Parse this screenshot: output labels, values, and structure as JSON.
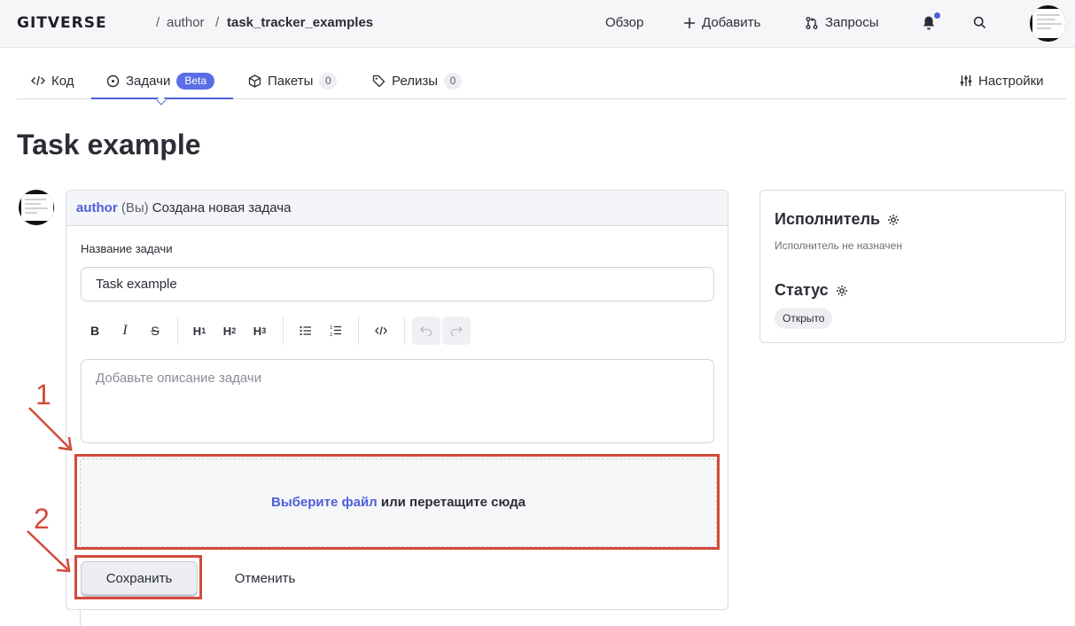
{
  "header": {
    "logo": "GITVERSE",
    "separator": "/",
    "owner": "author",
    "repo": "task_tracker_examples",
    "nav": {
      "overview": "Обзор",
      "add": "Добавить",
      "requests": "Запросы"
    },
    "icons": [
      "plus-icon",
      "pull-request-icon",
      "bell-icon",
      "search-icon"
    ]
  },
  "tabs": {
    "code": "Код",
    "issues": "Задачи",
    "issues_badge": "Beta",
    "packages": "Пакеты",
    "packages_count": "0",
    "releases": "Релизы",
    "releases_count": "0",
    "settings": "Настройки"
  },
  "page": {
    "title": "Task example"
  },
  "comment": {
    "author": "author",
    "you": "(Вы)",
    "action": "Создана новая задача",
    "title_label": "Название задачи",
    "title_value": "Task example",
    "toolbar": {
      "bold": "B",
      "italic": "I",
      "strike": "S",
      "h1": "H",
      "h1_sub": "1",
      "h2": "H",
      "h2_sub": "2",
      "h3": "H",
      "h3_sub": "3"
    },
    "description_placeholder": "Добавьте описание задачи",
    "dropzone_link": "Выберите файл",
    "dropzone_text": " или перетащите сюда",
    "save": "Сохранить",
    "cancel": "Отменить"
  },
  "sidebar": {
    "assignee_title": "Исполнитель",
    "assignee_empty": "Исполнитель не назначен",
    "status_title": "Статус",
    "status_value": "Открыто"
  },
  "annotations": {
    "one": "1",
    "two": "2"
  },
  "colors": {
    "accent": "#4e5fd9",
    "annotation": "#d34a3b",
    "header_bg": "#f5f6f8"
  }
}
